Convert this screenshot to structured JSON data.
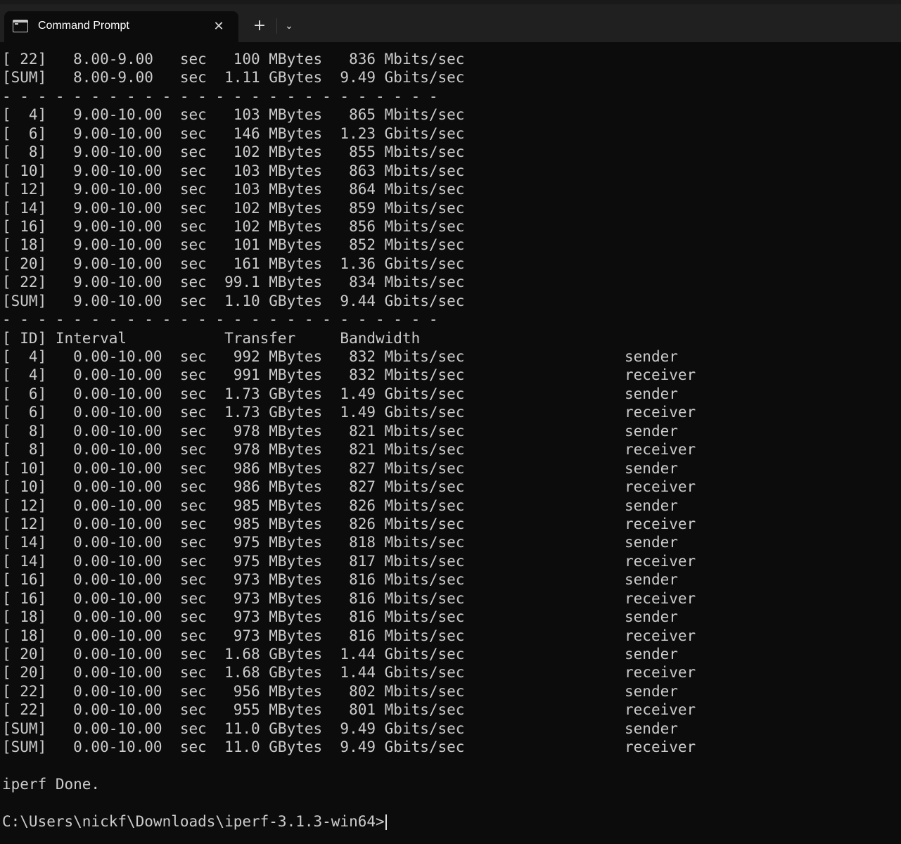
{
  "tab": {
    "title": "Command Prompt",
    "icon": "terminal-icon",
    "close_glyph": "✕",
    "new_tab_glyph": "+",
    "dropdown_glyph": "⌄"
  },
  "terminal": {
    "lines": [
      "[ 22]   8.00-9.00   sec   100 MBytes   836 Mbits/sec",
      "[SUM]   8.00-9.00   sec  1.11 GBytes  9.49 Gbits/sec",
      "- - - - - - - - - - - - - - - - - - - - - - - - -",
      "[  4]   9.00-10.00  sec   103 MBytes   865 Mbits/sec",
      "[  6]   9.00-10.00  sec   146 MBytes  1.23 Gbits/sec",
      "[  8]   9.00-10.00  sec   102 MBytes   855 Mbits/sec",
      "[ 10]   9.00-10.00  sec   103 MBytes   863 Mbits/sec",
      "[ 12]   9.00-10.00  sec   103 MBytes   864 Mbits/sec",
      "[ 14]   9.00-10.00  sec   102 MBytes   859 Mbits/sec",
      "[ 16]   9.00-10.00  sec   102 MBytes   856 Mbits/sec",
      "[ 18]   9.00-10.00  sec   101 MBytes   852 Mbits/sec",
      "[ 20]   9.00-10.00  sec   161 MBytes  1.36 Gbits/sec",
      "[ 22]   9.00-10.00  sec  99.1 MBytes   834 Mbits/sec",
      "[SUM]   9.00-10.00  sec  1.10 GBytes  9.44 Gbits/sec",
      "- - - - - - - - - - - - - - - - - - - - - - - - -",
      "[ ID] Interval           Transfer     Bandwidth",
      "[  4]   0.00-10.00  sec   992 MBytes   832 Mbits/sec                  sender",
      "[  4]   0.00-10.00  sec   991 MBytes   832 Mbits/sec                  receiver",
      "[  6]   0.00-10.00  sec  1.73 GBytes  1.49 Gbits/sec                  sender",
      "[  6]   0.00-10.00  sec  1.73 GBytes  1.49 Gbits/sec                  receiver",
      "[  8]   0.00-10.00  sec   978 MBytes   821 Mbits/sec                  sender",
      "[  8]   0.00-10.00  sec   978 MBytes   821 Mbits/sec                  receiver",
      "[ 10]   0.00-10.00  sec   986 MBytes   827 Mbits/sec                  sender",
      "[ 10]   0.00-10.00  sec   986 MBytes   827 Mbits/sec                  receiver",
      "[ 12]   0.00-10.00  sec   985 MBytes   826 Mbits/sec                  sender",
      "[ 12]   0.00-10.00  sec   985 MBytes   826 Mbits/sec                  receiver",
      "[ 14]   0.00-10.00  sec   975 MBytes   818 Mbits/sec                  sender",
      "[ 14]   0.00-10.00  sec   975 MBytes   817 Mbits/sec                  receiver",
      "[ 16]   0.00-10.00  sec   973 MBytes   816 Mbits/sec                  sender",
      "[ 16]   0.00-10.00  sec   973 MBytes   816 Mbits/sec                  receiver",
      "[ 18]   0.00-10.00  sec   973 MBytes   816 Mbits/sec                  sender",
      "[ 18]   0.00-10.00  sec   973 MBytes   816 Mbits/sec                  receiver",
      "[ 20]   0.00-10.00  sec  1.68 GBytes  1.44 Gbits/sec                  sender",
      "[ 20]   0.00-10.00  sec  1.68 GBytes  1.44 Gbits/sec                  receiver",
      "[ 22]   0.00-10.00  sec   956 MBytes   802 Mbits/sec                  sender",
      "[ 22]   0.00-10.00  sec   955 MBytes   801 Mbits/sec                  receiver",
      "[SUM]   0.00-10.00  sec  11.0 GBytes  9.49 Gbits/sec                  sender",
      "[SUM]   0.00-10.00  sec  11.0 GBytes  9.49 Gbits/sec                  receiver",
      "",
      "iperf Done.",
      "",
      "C:\\Users\\nickf\\Downloads\\iperf-3.1.3-win64>"
    ]
  },
  "colors": {
    "background": "#0c0c0c",
    "text": "#cccccc",
    "tabbar": "#202020"
  }
}
